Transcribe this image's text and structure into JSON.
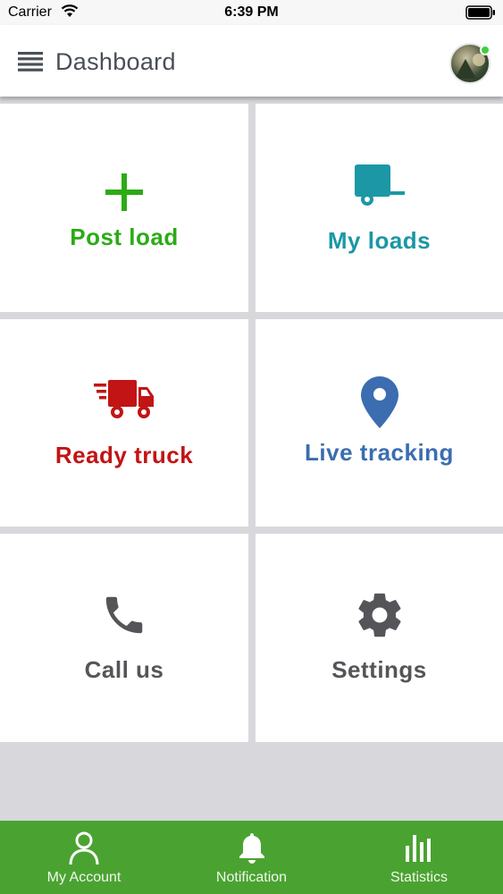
{
  "status_bar": {
    "carrier": "Carrier",
    "time": "6:39 PM"
  },
  "header": {
    "title": "Dashboard",
    "menu_icon": "hamburger-menu-icon",
    "avatar_status": "online"
  },
  "tiles": [
    {
      "label": "Post load",
      "icon": "plus-icon",
      "color": "#2cab16"
    },
    {
      "label": "My loads",
      "icon": "trailer-icon",
      "color": "#1b97a6"
    },
    {
      "label": "Ready truck",
      "icon": "fast-truck-icon",
      "color": "#c21414"
    },
    {
      "label": "Live tracking",
      "icon": "location-pin-icon",
      "color": "#3b6db0"
    },
    {
      "label": "Call us",
      "icon": "phone-icon",
      "color": "#555559"
    },
    {
      "label": "Settings",
      "icon": "gear-icon",
      "color": "#555559"
    }
  ],
  "tabbar": {
    "color": "#4aa331",
    "items": [
      {
        "label": "My Account",
        "icon": "user-icon"
      },
      {
        "label": "Notification",
        "icon": "bell-icon"
      },
      {
        "label": "Statistics",
        "icon": "bar-chart-icon"
      }
    ]
  }
}
